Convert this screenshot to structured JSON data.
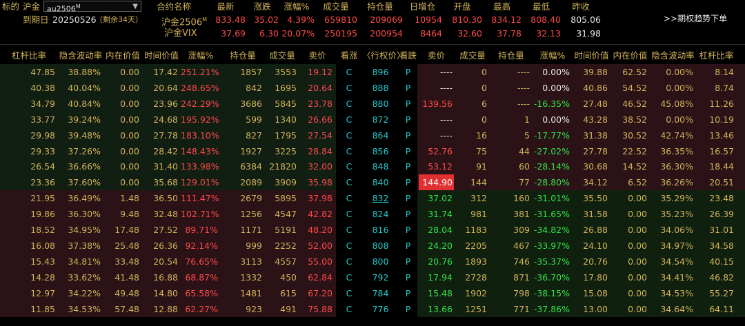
{
  "header": {
    "label_biaode": "标的",
    "underlying_name": "沪金",
    "selector_value": "au2506",
    "selector_sup": "M",
    "expiry_label": "到期日",
    "expiry_date": "20250526",
    "days_left": "（剩余34天）",
    "trend_button": ">>期权趋势下单",
    "table_cols": [
      "合约名称",
      "最新",
      "涨跌",
      "涨幅%",
      "成交量",
      "持仓量",
      "日增仓",
      "开盘",
      "最高",
      "最低",
      "昨收"
    ],
    "rows": [
      {
        "name": "沪金2506",
        "sup": "M",
        "last": "833.48",
        "chg": "35.02",
        "pct": "4.39%",
        "vol": "659810",
        "oi": "209069",
        "doi": "10954",
        "open": "810.30",
        "high": "834.12",
        "low": "808.40",
        "prev": "805.06"
      },
      {
        "name": "沪金VIX",
        "sup": "",
        "last": "37.69",
        "chg": "6.30",
        "pct": "20.07%",
        "vol": "250195",
        "oi": "200954",
        "doi": "8464",
        "open": "32.60",
        "high": "37.78",
        "low": "32.13",
        "prev": "31.98"
      }
    ]
  },
  "columns": [
    "杠杆比率",
    "隐含波动率",
    "内在价值",
    "时间价值",
    "涨幅%",
    "持仓量",
    "成交量",
    "卖价",
    "看涨",
    "〈行权价〉",
    "看跌",
    "卖价",
    "成交量",
    "持仓量",
    "涨幅%",
    "时间价值",
    "内在价值",
    "隐含波动率",
    "杠杆比率"
  ],
  "rows": [
    {
      "c": [
        "47.85",
        "38.88%",
        "0.00",
        "17.42",
        "251.21%",
        "1857",
        "3553",
        "19.12"
      ],
      "call": "C",
      "strike": "896",
      "put": "P",
      "p": [
        "----",
        "0",
        "----",
        "0.00%",
        "39.88",
        "62.52",
        "0.00%",
        "8.14"
      ]
    },
    {
      "c": [
        "40.38",
        "40.04%",
        "0.00",
        "20.64",
        "248.65%",
        "842",
        "1695",
        "20.64"
      ],
      "call": "C",
      "strike": "888",
      "put": "P",
      "p": [
        "----",
        "0",
        "----",
        "0.00%",
        "40.86",
        "54.52",
        "0.00%",
        "8.74"
      ]
    },
    {
      "c": [
        "34.79",
        "40.84%",
        "0.00",
        "23.96",
        "242.29%",
        "3686",
        "5845",
        "23.78"
      ],
      "call": "C",
      "strike": "880",
      "put": "P",
      "p": [
        "139.56",
        "6",
        "----",
        "-16.35%",
        "27.48",
        "46.52",
        "45.08%",
        "11.26"
      ]
    },
    {
      "c": [
        "33.77",
        "39.24%",
        "0.00",
        "24.68",
        "195.92%",
        "599",
        "1340",
        "26.66"
      ],
      "call": "C",
      "strike": "872",
      "put": "P",
      "p": [
        "----",
        "0",
        "1",
        "0.00%",
        "43.28",
        "38.52",
        "0.00%",
        "10.19"
      ]
    },
    {
      "c": [
        "29.98",
        "39.48%",
        "0.00",
        "27.78",
        "183.10%",
        "827",
        "1795",
        "27.54"
      ],
      "call": "C",
      "strike": "864",
      "put": "P",
      "p": [
        "----",
        "16",
        "5",
        "-17.77%",
        "31.38",
        "30.52",
        "42.74%",
        "13.46"
      ]
    },
    {
      "c": [
        "29.33",
        "37.26%",
        "0.00",
        "28.42",
        "148.43%",
        "1927",
        "3225",
        "28.84"
      ],
      "call": "C",
      "strike": "856",
      "put": "P",
      "p": [
        "52.76",
        "75",
        "44",
        "-27.02%",
        "27.78",
        "22.52",
        "36.35%",
        "16.57"
      ]
    },
    {
      "c": [
        "26.54",
        "36.66%",
        "0.00",
        "31.40",
        "133.98%",
        "6384",
        "21820",
        "32.00"
      ],
      "call": "C",
      "strike": "848",
      "put": "P",
      "p": [
        "53.12",
        "91",
        "60",
        "-28.14%",
        "30.68",
        "14.52",
        "36.30%",
        "18.44"
      ]
    },
    {
      "c": [
        "23.36",
        "37.60%",
        "0.00",
        "35.68",
        "129.01%",
        "2089",
        "3909",
        "35.98"
      ],
      "call": "C",
      "strike": "840",
      "put": "P",
      "p": [
        "144.90",
        "144",
        "77",
        "-28.80%",
        "34.12",
        "6.52",
        "36.26%",
        "20.51"
      ]
    },
    {
      "c": [
        "21.95",
        "36.49%",
        "1.48",
        "36.50",
        "111.47%",
        "2679",
        "5895",
        "37.98"
      ],
      "call": "C",
      "strike": "832",
      "put": "P",
      "p": [
        "37.02",
        "312",
        "160",
        "-31.01%",
        "35.50",
        "0.00",
        "35.29%",
        "23.48"
      ]
    },
    {
      "c": [
        "19.86",
        "36.30%",
        "9.48",
        "32.48",
        "102.71%",
        "1256",
        "4547",
        "42.82"
      ],
      "call": "C",
      "strike": "824",
      "put": "P",
      "p": [
        "31.74",
        "981",
        "381",
        "-31.65%",
        "31.58",
        "0.00",
        "35.23%",
        "26.39"
      ]
    },
    {
      "c": [
        "18.52",
        "34.95%",
        "17.48",
        "27.52",
        "89.71%",
        "1171",
        "5191",
        "48.20"
      ],
      "call": "C",
      "strike": "816",
      "put": "P",
      "p": [
        "28.04",
        "1183",
        "309",
        "-34.82%",
        "26.88",
        "0.00",
        "34.06%",
        "31.01"
      ]
    },
    {
      "c": [
        "16.08",
        "37.38%",
        "25.48",
        "26.36",
        "92.14%",
        "999",
        "2252",
        "52.00"
      ],
      "call": "C",
      "strike": "808",
      "put": "P",
      "p": [
        "24.20",
        "2205",
        "467",
        "-33.97%",
        "24.10",
        "0.00",
        "34.97%",
        "34.58"
      ]
    },
    {
      "c": [
        "15.43",
        "34.81%",
        "33.48",
        "20.54",
        "76.65%",
        "3113",
        "4557",
        "55.00"
      ],
      "call": "C",
      "strike": "800",
      "put": "P",
      "p": [
        "20.76",
        "1893",
        "746",
        "-35.37%",
        "20.76",
        "0.00",
        "34.54%",
        "40.15"
      ]
    },
    {
      "c": [
        "14.28",
        "33.62%",
        "41.48",
        "16.88",
        "68.87%",
        "1332",
        "450",
        "62.84"
      ],
      "call": "C",
      "strike": "792",
      "put": "P",
      "p": [
        "17.94",
        "2728",
        "871",
        "-36.70%",
        "17.80",
        "0.00",
        "34.41%",
        "46.82"
      ]
    },
    {
      "c": [
        "12.97",
        "34.22%",
        "49.48",
        "14.80",
        "65.58%",
        "1481",
        "615",
        "67.20"
      ],
      "call": "C",
      "strike": "784",
      "put": "P",
      "p": [
        "15.48",
        "1902",
        "798",
        "-38.15%",
        "15.08",
        "0.00",
        "34.53%",
        "55.27"
      ]
    },
    {
      "c": [
        "11.85",
        "34.53%",
        "57.48",
        "12.88",
        "62.27%",
        "923",
        "491",
        "75.88"
      ],
      "call": "C",
      "strike": "776",
      "put": "P",
      "p": [
        "13.66",
        "1251",
        "771",
        "-37.86%",
        "13.00",
        "0.00",
        "34.64%",
        "64.11"
      ]
    }
  ],
  "colors": {
    "up": "#ff4a4a",
    "down": "#33e14a",
    "gold": "#d2b35a",
    "cyan": "#27c6c6",
    "highlight": "#e13030"
  }
}
